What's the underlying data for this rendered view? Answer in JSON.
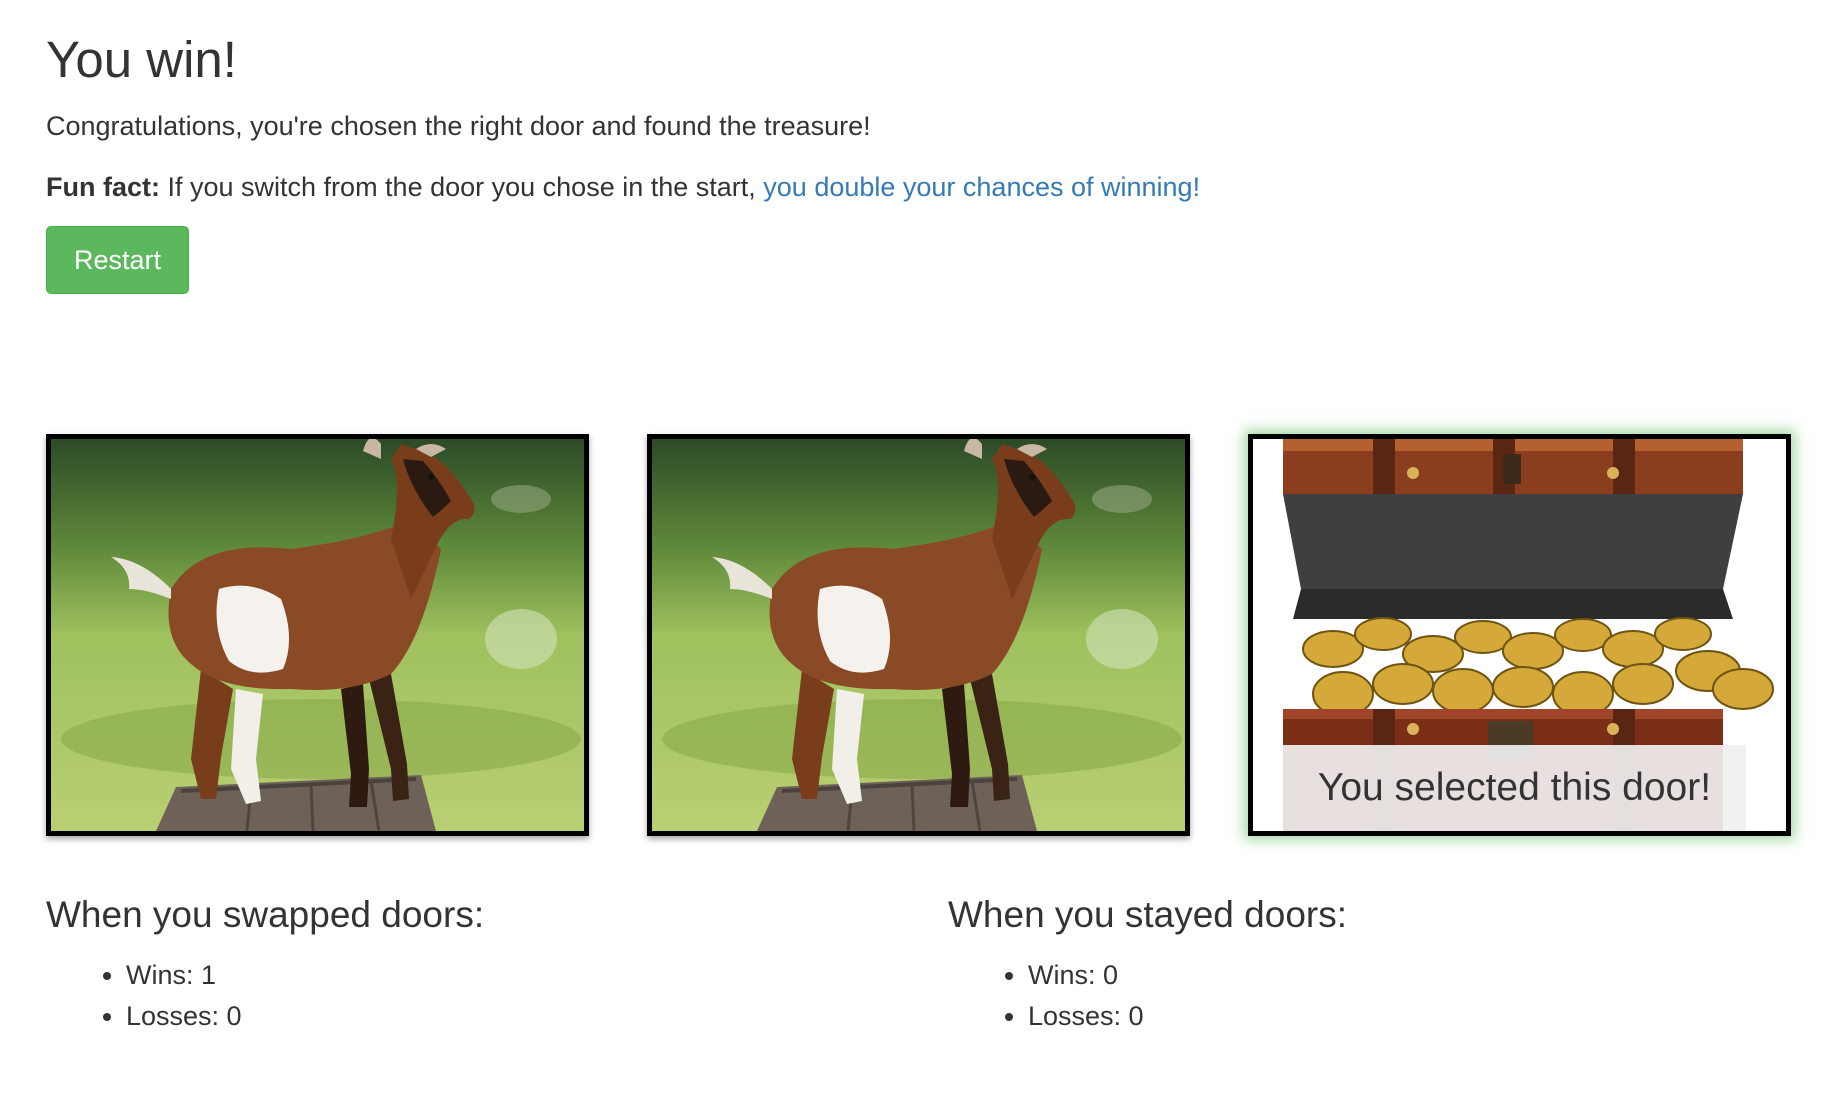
{
  "header": {
    "title": "You win!",
    "message": "Congratulations, you're chosen the right door and found the treasure!",
    "fun_fact_label": "Fun fact:",
    "fun_fact_text": " If you switch from the door you chose in the start, ",
    "fun_fact_link": "you double your chances of winning!"
  },
  "restart_label": "Restart",
  "doors": [
    {
      "content": "goat",
      "selected": false
    },
    {
      "content": "goat",
      "selected": false
    },
    {
      "content": "treasure",
      "selected": true,
      "caption": "You selected this door!"
    }
  ],
  "stats": {
    "swapped": {
      "heading": "When you swapped doors:",
      "wins": "Wins: 1",
      "losses": "Losses: 0"
    },
    "stayed": {
      "heading": "When you stayed doors:",
      "wins": "Wins: 0",
      "losses": "Losses: 0"
    }
  },
  "colors": {
    "restart_bg": "#5cb85c",
    "link": "#337ab7",
    "selected_glow": "#5cb85c"
  }
}
